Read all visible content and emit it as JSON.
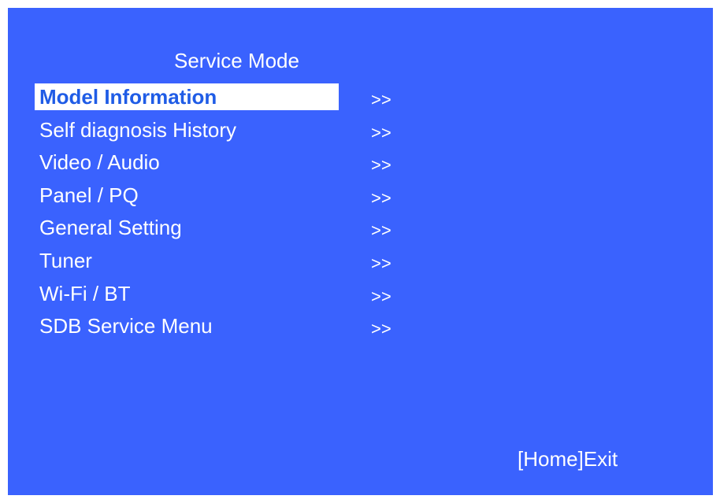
{
  "screen": {
    "title": "Service Mode",
    "exit_hint": "[Home]Exit",
    "background_color": "#3a62fe",
    "highlight_color": "#ffffff",
    "selected_text_color": "#1f5ce6"
  },
  "menu": {
    "selected_index": 0,
    "items": [
      {
        "label": "Model Information",
        "arrow": ">>"
      },
      {
        "label": "Self diagnosis History",
        "arrow": ">>"
      },
      {
        "label": "Video / Audio",
        "arrow": ">>"
      },
      {
        "label": "Panel / PQ",
        "arrow": ">>"
      },
      {
        "label": "General Setting",
        "arrow": ">>"
      },
      {
        "label": "Tuner",
        "arrow": ">>"
      },
      {
        "label": "Wi-Fi / BT",
        "arrow": ">>"
      },
      {
        "label": "SDB Service Menu",
        "arrow": ">>"
      }
    ]
  }
}
